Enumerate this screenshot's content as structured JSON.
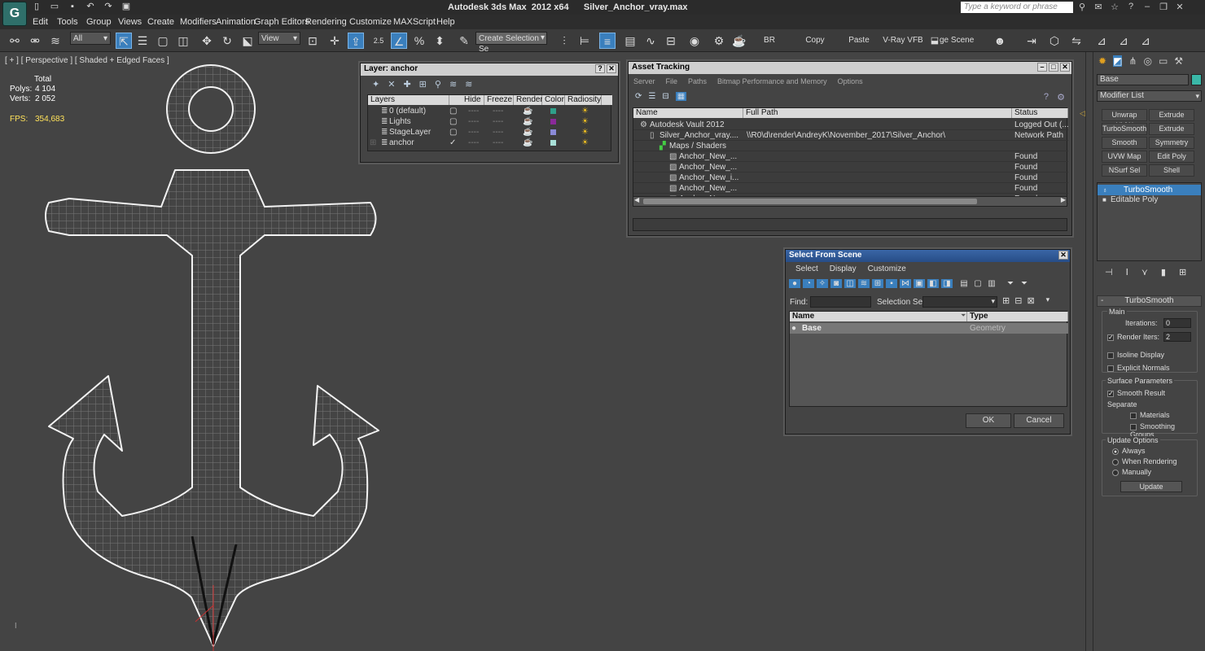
{
  "app": {
    "title": "Autodesk 3ds Max  2012 x64      Silver_Anchor_vray.max",
    "logo": "3ds-max-logo",
    "search_placeholder": "Type a keyword or phrase"
  },
  "menu": [
    "Edit",
    "Tools",
    "Group",
    "Views",
    "Create",
    "Modifiers",
    "Animation",
    "Graph Editors",
    "Rendering",
    "Customize",
    "MAXScript",
    "Help"
  ],
  "toolbar": {
    "filter": "All",
    "coord": "View",
    "snap_value": "2.5",
    "named_selection": "Create Selection Se",
    "br": "BR",
    "copy": "Copy",
    "paste": "Paste",
    "vfb": "V-Ray VFB",
    "stage": "ge Scene Stat"
  },
  "viewport": {
    "label": "[ + ] [ Perspective ] [ Shaded + Edged Faces ]",
    "stats": {
      "total_label": "Total",
      "polys_label": "Polys:",
      "polys": "4 104",
      "verts_label": "Verts:",
      "verts": "2 052",
      "fps_label": "FPS:",
      "fps": "354,683"
    }
  },
  "layer_window": {
    "title": "Layer: anchor",
    "columns": [
      "Layers",
      "Hide",
      "Freeze",
      "Render",
      "Color",
      "Radiosity"
    ],
    "rows": [
      {
        "name": "0 (default)",
        "color": "#2fa08a",
        "current": false
      },
      {
        "name": "Lights",
        "color": "#8a2a9a",
        "current": false
      },
      {
        "name": "StageLayer",
        "color": "#8a8ad8",
        "current": false
      },
      {
        "name": "anchor",
        "color": "#a8e0d8",
        "current": true
      }
    ],
    "dash": "----"
  },
  "asset_window": {
    "title": "Asset Tracking",
    "menu": [
      "Server",
      "File",
      "Paths",
      "Bitmap Performance and Memory",
      "Options"
    ],
    "columns": [
      "Name",
      "Full Path",
      "Status"
    ],
    "rows": [
      {
        "name": "Autodesk Vault 2012",
        "path": "",
        "status": "Logged Out (...",
        "indent": 1
      },
      {
        "name": "Silver_Anchor_vray....",
        "path": "\\\\R0\\d\\render\\AndreyK\\November_2017\\Silver_Anchor\\",
        "status": "Network Path",
        "indent": 2
      },
      {
        "name": "Maps / Shaders",
        "path": "",
        "status": "",
        "indent": 3
      },
      {
        "name": "Anchor_New_...",
        "path": "",
        "status": "Found",
        "indent": 4
      },
      {
        "name": "Anchor_New_...",
        "path": "",
        "status": "Found",
        "indent": 4
      },
      {
        "name": "Anchor_New_i...",
        "path": "",
        "status": "Found",
        "indent": 4
      },
      {
        "name": "Anchor_New_...",
        "path": "",
        "status": "Found",
        "indent": 4
      },
      {
        "name": "Anchor_New_...",
        "path": "",
        "status": "Found",
        "indent": 4
      }
    ]
  },
  "select_window": {
    "title": "Select From Scene",
    "menu": [
      "Select",
      "Display",
      "Customize"
    ],
    "find_label": "Find:",
    "selset_label": "Selection Set:",
    "columns": [
      "Name",
      "Type"
    ],
    "rows": [
      {
        "name": "Base",
        "type": "Geometry"
      }
    ],
    "ok": "OK",
    "cancel": "Cancel"
  },
  "command_panel": {
    "object_name": "Base",
    "object_color": "#3ab8a8",
    "modifier_list": "Modifier List",
    "buttons": [
      "Unwrap UVW",
      "Extrude",
      "TurboSmooth",
      "Extrude",
      "Smooth",
      "Symmetry",
      "UVW Map",
      "Edit Poly",
      "NSurf Sel",
      "Shell"
    ],
    "stack": [
      {
        "name": "TurboSmooth",
        "selected": true
      },
      {
        "name": "Editable Poly",
        "selected": false
      }
    ],
    "rollout": {
      "title": "TurboSmooth",
      "main": "Main",
      "iterations_label": "Iterations:",
      "iterations": "0",
      "render_iters_label": "Render Iters:",
      "render_iters": "2",
      "isoline": "Isoline Display",
      "explicit": "Explicit Normals",
      "surface": "Surface Parameters",
      "smooth_result": "Smooth Result",
      "separate": "Separate",
      "materials": "Materials",
      "smoothing_groups": "Smoothing Groups",
      "update_options": "Update Options",
      "always": "Always",
      "when_rendering": "When Rendering",
      "manually": "Manually",
      "update": "Update"
    }
  }
}
